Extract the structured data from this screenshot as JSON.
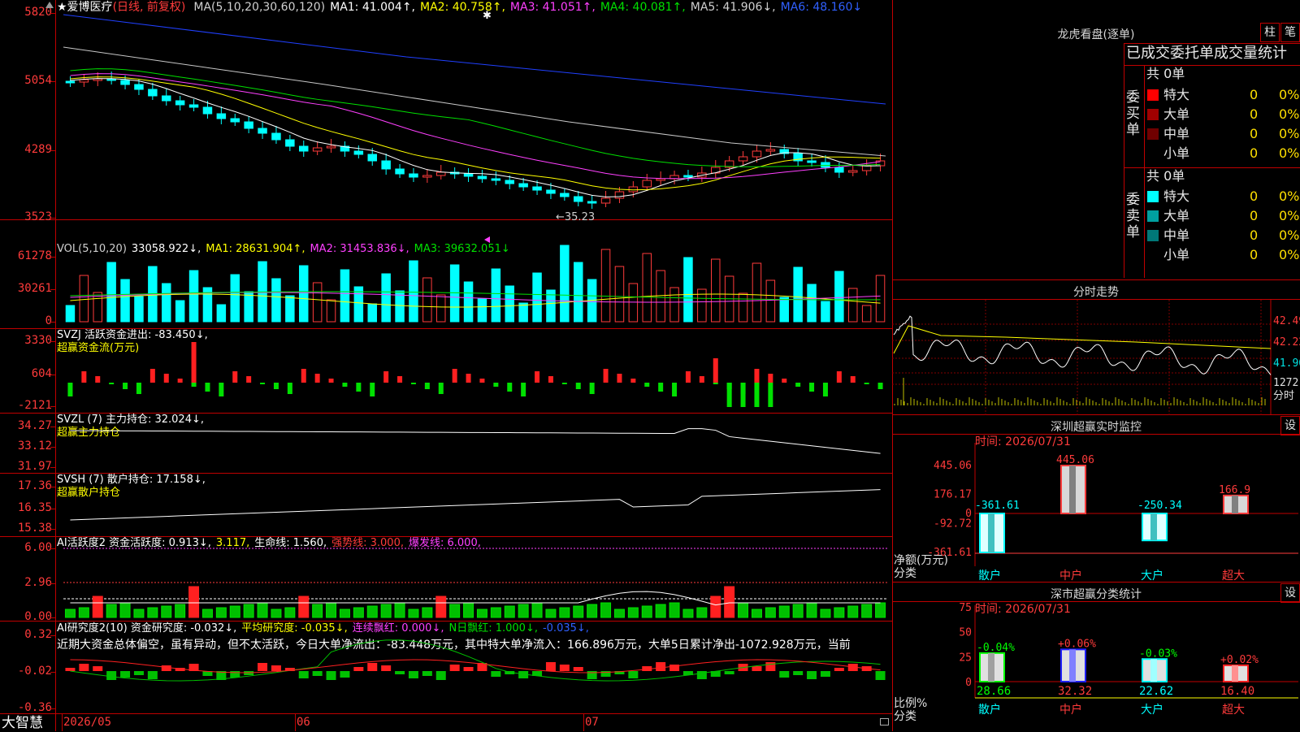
{
  "stock": {
    "name": "★爱博医疗",
    "mode": "(日线, 前复权)"
  },
  "main_axis": [
    "5820",
    "5054",
    "4289",
    "3523"
  ],
  "main_ma_header": [
    {
      "text": "MA(5,10,20,30,60,120)",
      "color": "#d0d0d0"
    },
    {
      "text": "MA1: 41.004↑,",
      "color": "#ffffff"
    },
    {
      "text": "MA2: 40.758↑,",
      "color": "#ffff00"
    },
    {
      "text": "MA3: 41.051↑,",
      "color": "#ff40ff"
    },
    {
      "text": "MA4: 40.081↑,",
      "color": "#00e000"
    },
    {
      "text": "MA5: 41.906↓,",
      "color": "#d0d0d0"
    },
    {
      "text": "MA6: 48.160↓",
      "color": "#3060ff"
    }
  ],
  "low_marker": "←35.23",
  "vol": {
    "axis": [
      "61278",
      "30261",
      "0"
    ],
    "header": [
      {
        "text": "VOL(5,10,20)",
        "color": "#d0d0d0"
      },
      {
        "text": "33058.922↓,",
        "color": "#ffffff"
      },
      {
        "text": "MA1: 28631.904↑,",
        "color": "#ffff00"
      },
      {
        "text": "MA2: 31453.836↓,",
        "color": "#ff40ff"
      },
      {
        "text": "MA3: 39632.051↓",
        "color": "#00e000"
      }
    ]
  },
  "svzj": {
    "axis": [
      "3330",
      "604",
      "-2121"
    ],
    "header": [
      {
        "text": "SVZJ  活跃资金进出: -83.450↓,",
        "color": "#ffffff"
      }
    ],
    "sub": "超赢资金流(万元)"
  },
  "svzl": {
    "axis": [
      "34.27",
      "33.12",
      "31.97"
    ],
    "header": [
      {
        "text": "SVZL (7) 主力持仓: 32.024↓,",
        "color": "#ffffff"
      }
    ],
    "sub": "超赢主力持仓"
  },
  "svsh": {
    "axis": [
      "17.36",
      "16.35",
      "15.38"
    ],
    "header": [
      {
        "text": "SVSH (7) 散户持仓: 17.158↓,",
        "color": "#ffffff"
      }
    ],
    "sub": "超赢散户持仓"
  },
  "ai1": {
    "axis": [
      "6.00",
      "2.96",
      "0.00"
    ],
    "header": [
      {
        "text": "AI活跃度2 资金活跃度: 0.913↓,",
        "color": "#ffffff"
      },
      {
        "text": "3.117,",
        "color": "#ffff00"
      },
      {
        "text": "生命线: 1.560,",
        "color": "#ffffff"
      },
      {
        "text": "强势线: 3.000,",
        "color": "#ff3b3b"
      },
      {
        "text": "爆发线: 6.000,",
        "color": "#ff40ff"
      }
    ]
  },
  "ai2": {
    "axis": [
      "0.32",
      "-0.02",
      "-0.36"
    ],
    "header": [
      {
        "text": "AI研究度2(10) 资金研究度: -0.032↓,",
        "color": "#ffffff"
      },
      {
        "text": "平均研究度: -0.035↓,",
        "color": "#ffff00"
      },
      {
        "text": "连续飘红: 0.000↓,",
        "color": "#ff40ff"
      },
      {
        "text": "N日飘红: 1.000↓,",
        "color": "#00e000"
      },
      {
        "text": "-0.035↓,",
        "color": "#3060ff"
      }
    ],
    "sentence": "近期大资金总体偏空，虽有异动，但不太活跃，今日大单净流出：-83.448万元，其中特大单净流入：166.896万元，大单5日累计净出-1072.928万元，当前"
  },
  "date_axis": {
    "brand": "大智慧",
    "labels": [
      "2026/05",
      "06",
      "07"
    ]
  },
  "lhb": {
    "title": "龙虎看盘(逐单)",
    "btn1": "柱",
    "btn2": "笔",
    "subtitle": "已成交委托单成交量统计",
    "buy_group": "委买单",
    "sell_group": "委卖单",
    "buy_total": "共 0单",
    "sell_total": "共 0单",
    "buy_rows": [
      {
        "label": "特大",
        "value": "0",
        "pct": "0%",
        "color": "#ff0000"
      },
      {
        "label": "大单",
        "value": "0",
        "pct": "0%",
        "color": "#a00000"
      },
      {
        "label": "中单",
        "value": "0",
        "pct": "0%",
        "color": "#700000"
      },
      {
        "label": "小单",
        "value": "0",
        "pct": "0%",
        "color": "#000000"
      }
    ],
    "sell_rows": [
      {
        "label": "特大",
        "value": "0",
        "pct": "0%",
        "color": "#00ffff"
      },
      {
        "label": "大单",
        "value": "0",
        "pct": "0%",
        "color": "#00a0a0"
      },
      {
        "label": "中单",
        "value": "0",
        "pct": "0%",
        "color": "#007878"
      },
      {
        "label": "小单",
        "value": "0",
        "pct": "0%",
        "color": "#000000"
      }
    ]
  },
  "intraday": {
    "title": "分时走势",
    "axis": [
      "42.49",
      "42.22",
      "41.96",
      "1272",
      "分时"
    ]
  },
  "monitor": {
    "title": "深圳超赢实时监控",
    "btn": "设",
    "time": "时间: 2026/07/31",
    "axis": [
      "445.06",
      "176.17",
      "0",
      "-92.72",
      "-361.61"
    ],
    "ylabel": "净额(万元)",
    "xlabel": "分类",
    "categories": [
      "散户",
      "中户",
      "大户",
      "超大"
    ],
    "value_labels": [
      "-361.61",
      "445.06",
      "-250.34",
      "166.9"
    ]
  },
  "stats": {
    "title": "深市超赢分类统计",
    "btn": "设",
    "time": "时间: 2026/07/31",
    "axis": [
      "75",
      "50",
      "25",
      "0"
    ],
    "ylabel": "比例%",
    "xlabel": "分类",
    "categories": [
      "散户",
      "中户",
      "大户",
      "超大"
    ],
    "change_labels": [
      "-0.04%",
      "+0.06%",
      "-0.03%",
      "+0.02%"
    ],
    "value_labels": [
      "28.66",
      "32.32",
      "22.62",
      "16.40"
    ]
  },
  "colors": {
    "up": "#ff3b3b",
    "down": "#00ffff",
    "grid": "#c00000",
    "ma120": "#2040ff"
  }
}
